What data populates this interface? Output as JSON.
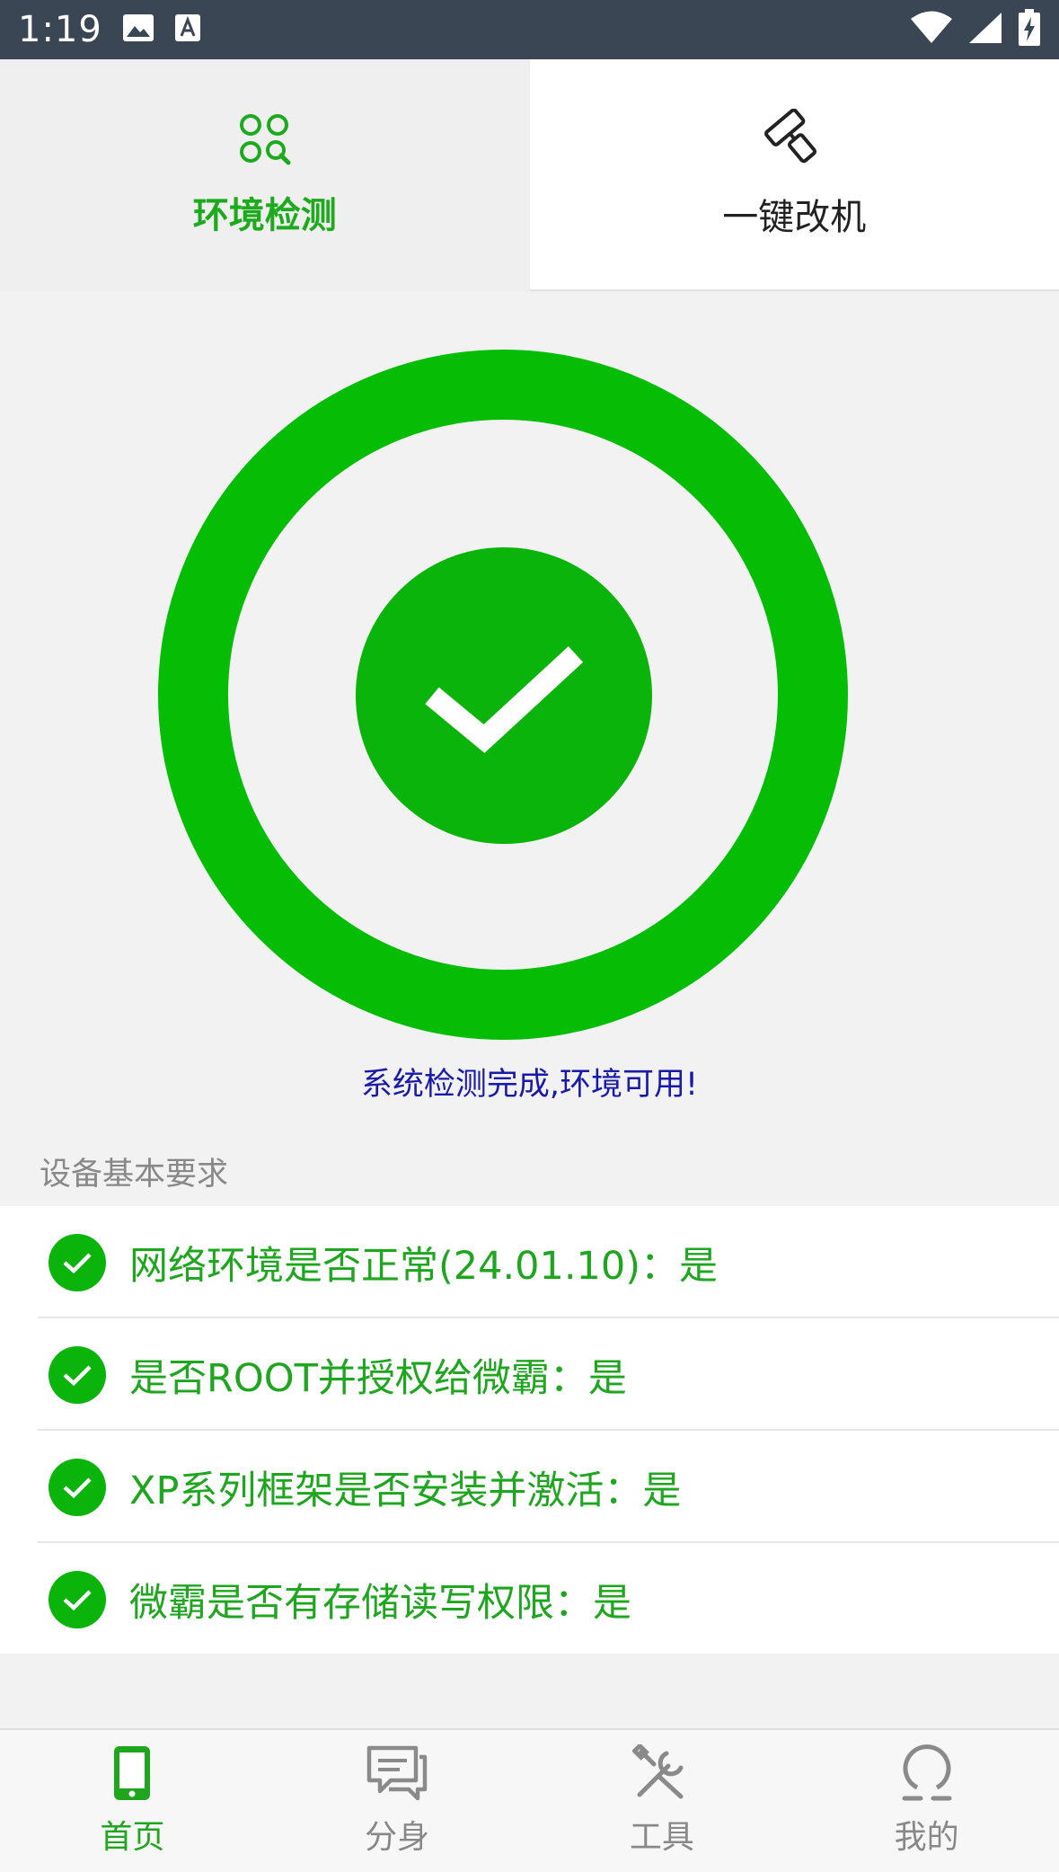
{
  "status_bar": {
    "time": "1:19",
    "icons": [
      "image-icon",
      "font-a-icon",
      "wifi-icon",
      "signal-icon",
      "battery-charging-icon"
    ]
  },
  "top_tabs": [
    {
      "label": "环境检测",
      "icon": "detect-grid-icon",
      "active": true
    },
    {
      "label": "一键改机",
      "icon": "paint-roller-icon",
      "active": false
    }
  ],
  "check_result": {
    "message": "系统检测完成,环境可用!",
    "icon": "big-check-icon"
  },
  "requirements": {
    "title": "设备基本要求",
    "items": [
      {
        "label": "网络环境是否正常(24.01.10)：是"
      },
      {
        "label": "是否ROOT并授权给微霸：是"
      },
      {
        "label": "XP系列框架是否安装并激活：是"
      },
      {
        "label": "微霸是否有存储读写权限：是"
      }
    ]
  },
  "bottom_nav": [
    {
      "label": "首页",
      "icon": "phone-icon",
      "active": true
    },
    {
      "label": "分身",
      "icon": "chat-bubble-icon",
      "active": false
    },
    {
      "label": "工具",
      "icon": "tools-icon",
      "active": false
    },
    {
      "label": "我的",
      "icon": "user-icon",
      "active": false
    }
  ],
  "colors": {
    "accent_green": "#06bd06",
    "label_green": "#1fa61f",
    "message_blue": "#1a1aaa",
    "status_bar": "#3a4654"
  }
}
